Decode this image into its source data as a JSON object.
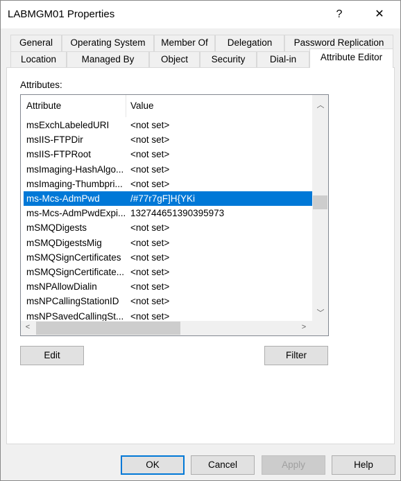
{
  "window": {
    "title": "LABMGM01 Properties",
    "help_glyph": "?",
    "close_glyph": "✕"
  },
  "tabs_row1": [
    "General",
    "Operating System",
    "Member Of",
    "Delegation",
    "Password Replication"
  ],
  "tabs_row2": [
    "Location",
    "Managed By",
    "Object",
    "Security",
    "Dial-in",
    "Attribute Editor"
  ],
  "selected_tab": "Attribute Editor",
  "attributes_label": "Attributes:",
  "table": {
    "columns": [
      "Attribute",
      "Value"
    ],
    "rows": [
      [
        "msExchLabeledURI",
        "<not set>"
      ],
      [
        "msIIS-FTPDir",
        "<not set>"
      ],
      [
        "msIIS-FTPRoot",
        "<not set>"
      ],
      [
        "msImaging-HashAlgo...",
        "<not set>"
      ],
      [
        "msImaging-Thumbpri...",
        "<not set>"
      ],
      [
        "ms-Mcs-AdmPwd",
        "/#77r7gF]H{YKi"
      ],
      [
        "ms-Mcs-AdmPwdExpi...",
        "132744651390395973"
      ],
      [
        "mSMQDigests",
        "<not set>"
      ],
      [
        "mSMQDigestsMig",
        "<not set>"
      ],
      [
        "mSMQSignCertificates",
        "<not set>"
      ],
      [
        "mSMQSignCertificate...",
        "<not set>"
      ],
      [
        "msNPAllowDialin",
        "<not set>"
      ],
      [
        "msNPCallingStationID",
        "<not set>"
      ],
      [
        "msNPSavedCallingSt...",
        "<not set>"
      ]
    ],
    "selected_row": 5
  },
  "buttons": {
    "edit": "Edit",
    "filter": "Filter",
    "ok": "OK",
    "cancel": "Cancel",
    "apply": "Apply",
    "help": "Help"
  },
  "colors": {
    "selection": "#0078d7"
  }
}
